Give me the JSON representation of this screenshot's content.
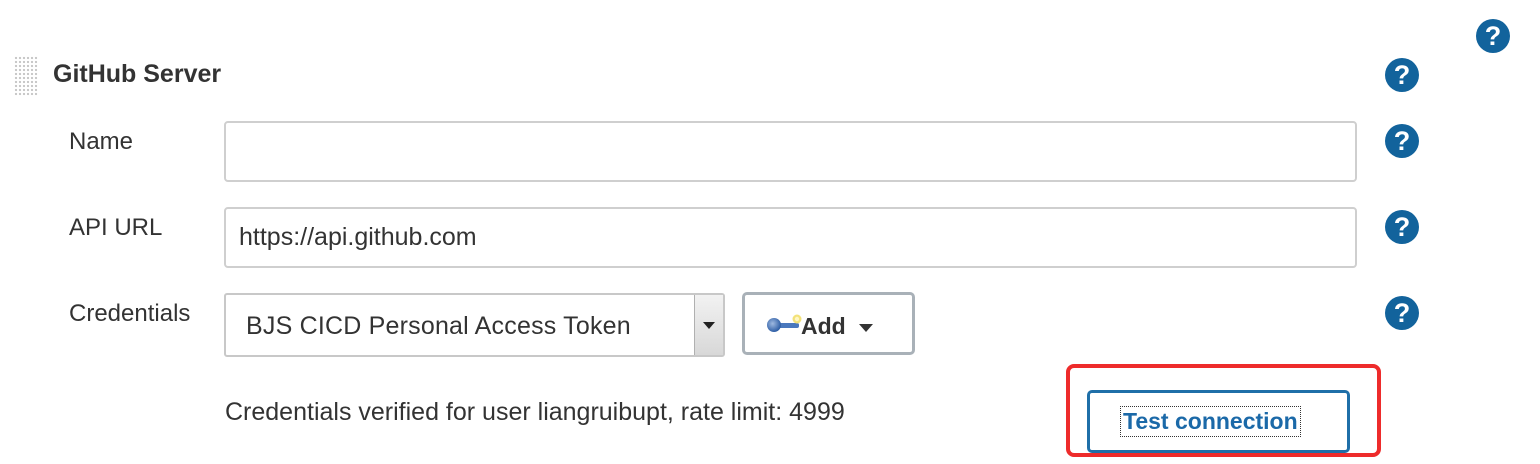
{
  "section": {
    "title": "GitHub Server"
  },
  "fields": {
    "name": {
      "label": "Name",
      "value": ""
    },
    "api_url": {
      "label": "API URL",
      "value": "https://api.github.com"
    },
    "credentials": {
      "label": "Credentials",
      "selected": "BJS CICD Personal Access Token",
      "add_label": "Add"
    }
  },
  "status": {
    "message": "Credentials verified for user liangruibupt, rate limit: 4999"
  },
  "actions": {
    "test_connection_label": "Test connection"
  },
  "help_icon_glyph": "?",
  "colors": {
    "help_icon": "#12639c",
    "test_button_text": "#1b69a8",
    "highlight": "#ee2b2b"
  },
  "icons": [
    "help-icon",
    "drag-handle-icon",
    "key-icon",
    "caret-down-icon"
  ]
}
